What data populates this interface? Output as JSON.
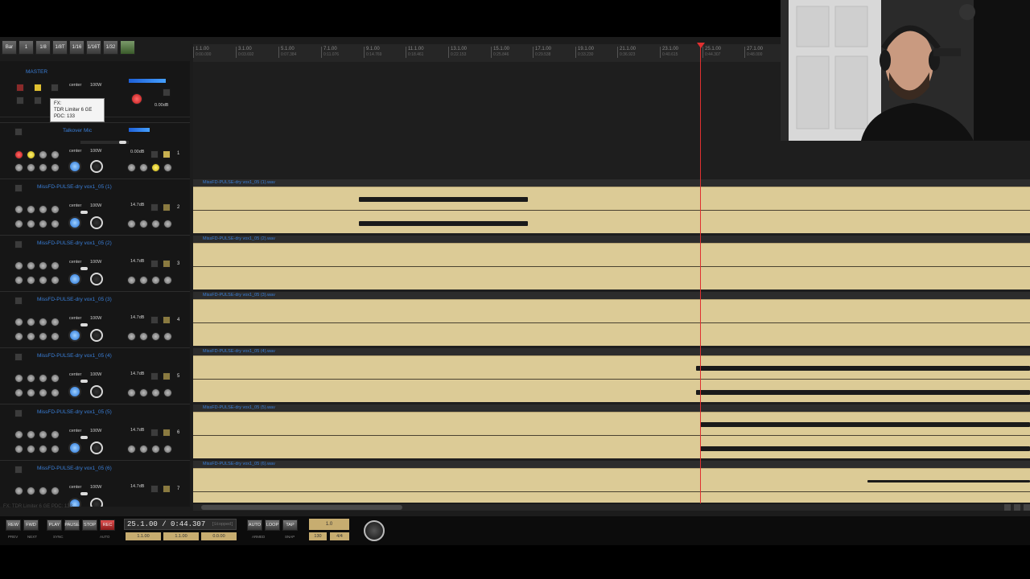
{
  "grid_toolbar": [
    "Bar",
    "1",
    "1/8",
    "1/8T",
    "1/16",
    "1/16T",
    "1/32",
    ""
  ],
  "master": {
    "name": "MASTER",
    "pan": "center",
    "width": "100W",
    "volume": "0.00dB",
    "tooltip_lines": [
      "FX:",
      "TDR Limiter 6 GE",
      "PDC: 133"
    ]
  },
  "talkover": {
    "name": "Talkover Mic",
    "pan": "center",
    "width": "100W",
    "volume": "0.00dB",
    "number": "1"
  },
  "tracks": [
    {
      "name": "MissFD-PULSE-dry vox1_05 (1)",
      "pan": "center",
      "width": "100W",
      "volume": "14.7dB",
      "number": "2",
      "clip": "MissFD-PULSE-dry vox1_05 (1).wav"
    },
    {
      "name": "MissFD-PULSE-dry vox1_05 (2)",
      "pan": "center",
      "width": "100W",
      "volume": "14.7dB",
      "number": "3",
      "clip": "MissFD-PULSE-dry vox1_05 (2).wav"
    },
    {
      "name": "MissFD-PULSE-dry vox1_05 (3)",
      "pan": "center",
      "width": "100W",
      "volume": "14.7dB",
      "number": "4",
      "clip": "MissFD-PULSE-dry vox1_05 (3).wav"
    },
    {
      "name": "MissFD-PULSE-dry vox1_05 (4)",
      "pan": "center",
      "width": "100W",
      "volume": "14.7dB",
      "number": "5",
      "clip": "MissFD-PULSE-dry vox1_05 (4).wav"
    },
    {
      "name": "MissFD-PULSE-dry vox1_05 (5)",
      "pan": "center",
      "width": "100W",
      "volume": "14.7dB",
      "number": "6",
      "clip": "MissFD-PULSE-dry vox1_05 (5).wav"
    },
    {
      "name": "MissFD-PULSE-dry vox1_05 (6)",
      "pan": "center",
      "width": "100W",
      "volume": "14.7dB",
      "number": "7",
      "clip": "MissFD-PULSE-dry vox1_05 (6).wav"
    }
  ],
  "ruler": [
    {
      "bar": "1.1.00",
      "time": "0:00.000"
    },
    {
      "bar": "3.1.00",
      "time": "0:03.692"
    },
    {
      "bar": "5.1.00",
      "time": "0:07.384"
    },
    {
      "bar": "7.1.00",
      "time": "0:11.076"
    },
    {
      "bar": "9.1.00",
      "time": "0:14.769"
    },
    {
      "bar": "11.1.00",
      "time": "0:18.461"
    },
    {
      "bar": "13.1.00",
      "time": "0:22.153"
    },
    {
      "bar": "15.1.00",
      "time": "0:25.846"
    },
    {
      "bar": "17.1.00",
      "time": "0:29.538"
    },
    {
      "bar": "19.1.00",
      "time": "0:33.230"
    },
    {
      "bar": "21.1.00",
      "time": "0:36.923"
    },
    {
      "bar": "23.1.00",
      "time": "0:40.615"
    },
    {
      "bar": "25.1.00",
      "time": "0:44.307"
    },
    {
      "bar": "27.1.00",
      "time": "0:48.000"
    }
  ],
  "status_fx": "FX: TDR Limiter 6 GE PDC: 133",
  "transport": {
    "buttons": [
      "REW",
      "FWD",
      "PLAY",
      "PAUSE",
      "STOP",
      "REC"
    ],
    "subs": [
      "PREV",
      "NEXT",
      "SYNC",
      "AUTO"
    ],
    "time": "25.1.00 / 0:44.307",
    "time_status": "[Stopped]",
    "sel_start": "1.1.00",
    "sel_end": "1.1.00",
    "sel_len": "0.0.00",
    "mode_buttons": [
      "AUTO",
      "LOOP",
      "TAP"
    ],
    "mode_subs": [
      "ARMED",
      "SNAP"
    ],
    "tempo": "1.0",
    "bpm": "130",
    "sig": "4/4"
  },
  "colors": {
    "clip": "#dccb96",
    "track_name": "#3a7fd8",
    "playhead": "#e03030"
  }
}
